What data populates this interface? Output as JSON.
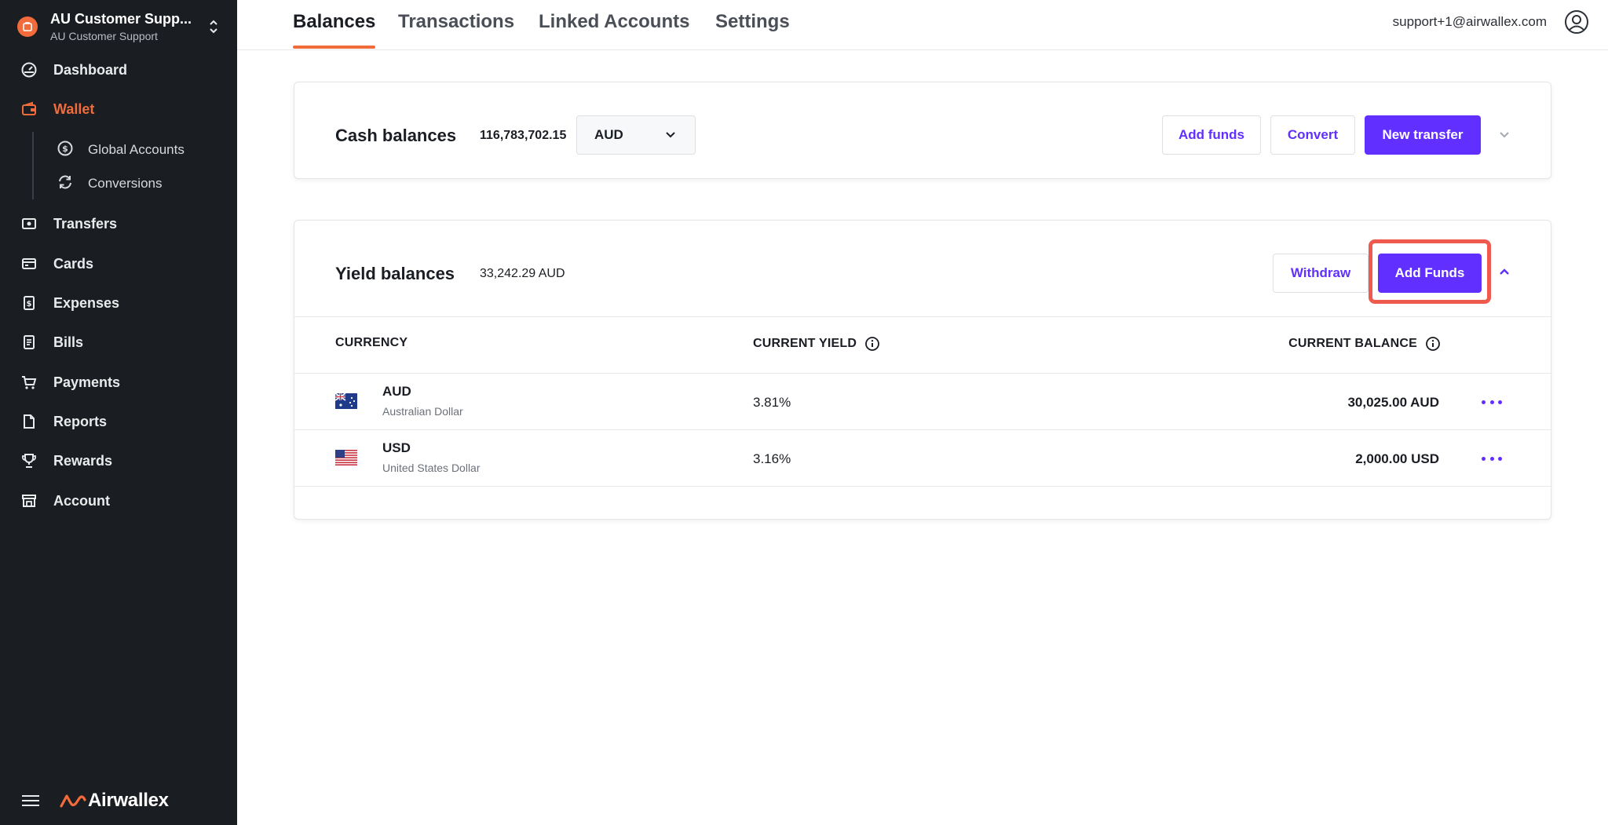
{
  "sidebar": {
    "org_name": "AU Customer Supp...",
    "org_sub": "AU Customer Support",
    "items": [
      {
        "label": "Dashboard",
        "icon": "dashboard-icon"
      },
      {
        "label": "Wallet",
        "icon": "wallet-icon",
        "active": true
      },
      {
        "label": "Transfers",
        "icon": "transfers-icon"
      },
      {
        "label": "Cards",
        "icon": "card-icon"
      },
      {
        "label": "Expenses",
        "icon": "expenses-icon"
      },
      {
        "label": "Bills",
        "icon": "bills-icon"
      },
      {
        "label": "Payments",
        "icon": "cart-icon"
      },
      {
        "label": "Reports",
        "icon": "report-icon"
      },
      {
        "label": "Rewards",
        "icon": "trophy-icon"
      },
      {
        "label": "Account",
        "icon": "store-icon"
      }
    ],
    "sub_items": [
      {
        "label": "Global Accounts",
        "icon": "dollar-circle-icon"
      },
      {
        "label": "Conversions",
        "icon": "refresh-icon"
      }
    ],
    "brand": "Airwallex"
  },
  "topbar": {
    "tabs": [
      "Balances",
      "Transactions",
      "Linked Accounts",
      "Settings"
    ],
    "active_tab": "Balances",
    "user_email": "support+1@airwallex.com"
  },
  "cash": {
    "title": "Cash balances",
    "amount": "116,783,702.15",
    "currency": "AUD",
    "add_funds": "Add funds",
    "convert": "Convert",
    "new_transfer": "New transfer"
  },
  "yield": {
    "title": "Yield balances",
    "amount": "33,242.29 AUD",
    "withdraw": "Withdraw",
    "add_funds": "Add Funds",
    "headers": {
      "currency": "CURRENCY",
      "current_yield": "CURRENT YIELD",
      "current_balance": "CURRENT BALANCE"
    },
    "rows": [
      {
        "code": "AUD",
        "name": "Australian Dollar",
        "yield": "3.81%",
        "balance": "30,025.00 AUD",
        "flag": "australia-flag-icon"
      },
      {
        "code": "USD",
        "name": "United States Dollar",
        "yield": "3.16%",
        "balance": "2,000.00 USD",
        "flag": "usa-flag-icon"
      }
    ]
  },
  "colors": {
    "accent": "#612fff",
    "brand_orange": "#f26b3a",
    "sidebar_bg": "#1a1d21",
    "highlight": "#ef5a4f"
  }
}
